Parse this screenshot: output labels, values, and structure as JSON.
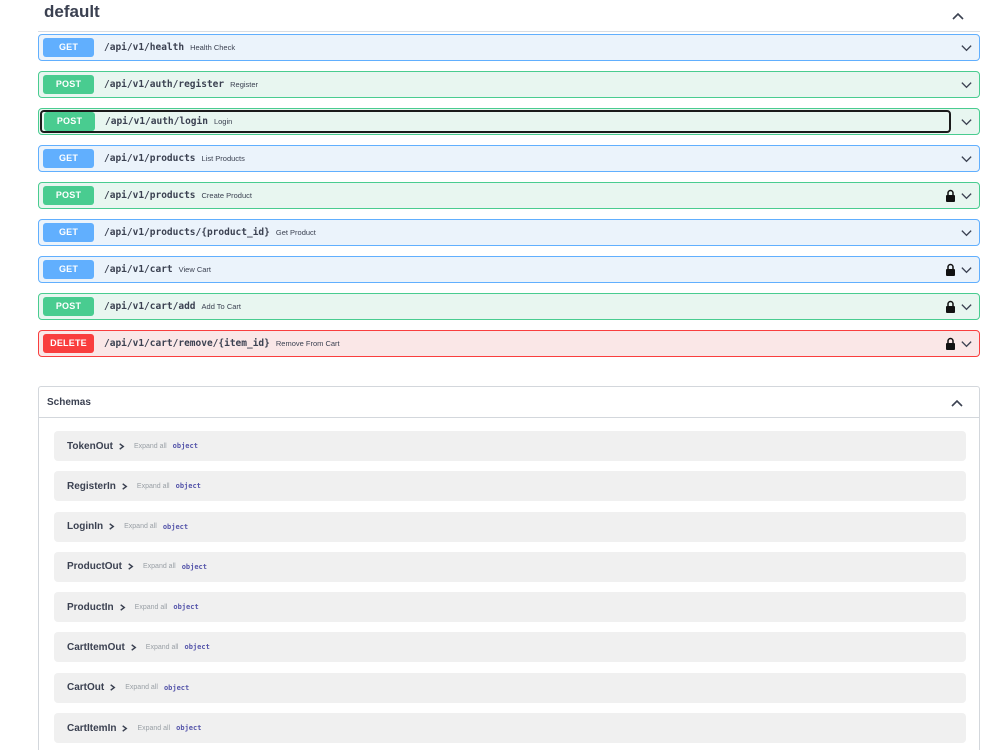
{
  "tag": {
    "title": "default"
  },
  "operations": [
    {
      "method": "GET",
      "kind": "get",
      "path": "/api/v1/health",
      "summary": "Health Check",
      "locked": false,
      "focused": false
    },
    {
      "method": "POST",
      "kind": "post",
      "path": "/api/v1/auth/register",
      "summary": "Register",
      "locked": false,
      "focused": false
    },
    {
      "method": "POST",
      "kind": "post",
      "path": "/api/v1/auth/login",
      "summary": "Login",
      "locked": false,
      "focused": true
    },
    {
      "method": "GET",
      "kind": "get",
      "path": "/api/v1/products",
      "summary": "List Products",
      "locked": false,
      "focused": false
    },
    {
      "method": "POST",
      "kind": "post",
      "path": "/api/v1/products",
      "summary": "Create Product",
      "locked": true,
      "focused": false
    },
    {
      "method": "GET",
      "kind": "get",
      "path": "/api/v1/products/{product_id}",
      "summary": "Get Product",
      "locked": false,
      "focused": false
    },
    {
      "method": "GET",
      "kind": "get",
      "path": "/api/v1/cart",
      "summary": "View Cart",
      "locked": true,
      "focused": false
    },
    {
      "method": "POST",
      "kind": "post",
      "path": "/api/v1/cart/add",
      "summary": "Add To Cart",
      "locked": true,
      "focused": false
    },
    {
      "method": "DELETE",
      "kind": "delete",
      "path": "/api/v1/cart/remove/{item_id}",
      "summary": "Remove From Cart",
      "locked": true,
      "focused": false
    }
  ],
  "schemas": {
    "title": "Schemas",
    "models": [
      {
        "name": "TokenOut",
        "expand_label": "Expand all",
        "type": "object"
      },
      {
        "name": "RegisterIn",
        "expand_label": "Expand all",
        "type": "object"
      },
      {
        "name": "LoginIn",
        "expand_label": "Expand all",
        "type": "object"
      },
      {
        "name": "ProductOut",
        "expand_label": "Expand all",
        "type": "object"
      },
      {
        "name": "ProductIn",
        "expand_label": "Expand all",
        "type": "object"
      },
      {
        "name": "CartItemOut",
        "expand_label": "Expand all",
        "type": "object"
      },
      {
        "name": "CartOut",
        "expand_label": "Expand all",
        "type": "object"
      },
      {
        "name": "CartItemIn",
        "expand_label": "Expand all",
        "type": "object"
      }
    ]
  },
  "icons": {
    "tag_toggle": "chevron-up-icon",
    "op_toggle": "chevron-down-icon",
    "auth": "lock-icon",
    "model_expand": "chevron-right-icon"
  },
  "colors": {
    "get": "#61affe",
    "post": "#49cc90",
    "delete": "#f93e3e"
  }
}
